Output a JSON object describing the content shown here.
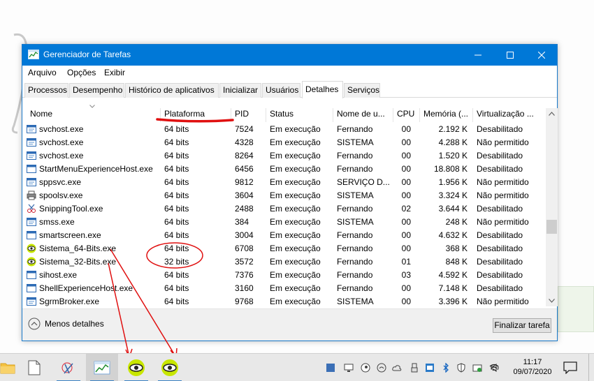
{
  "window": {
    "title": "Gerenciador de Tarefas",
    "accent": "#0078d7"
  },
  "menu": [
    "Arquivo",
    "Opções",
    "Exibir"
  ],
  "tabs": [
    "Processos",
    "Desempenho",
    "Histórico de aplicativos",
    "Inicializar",
    "Usuários",
    "Detalhes",
    "Serviços"
  ],
  "active_tab": "Detalhes",
  "columns": [
    "Nome",
    "Plataforma",
    "PID",
    "Status",
    "Nome de u...",
    "CPU",
    "Memória (...",
    "Virtualização ..."
  ],
  "rows": [
    {
      "name": "svchost.exe",
      "platform": "64 bits",
      "pid": "7524",
      "status": "Em execução",
      "user": "Fernando",
      "cpu": "00",
      "memory": "2.192 K",
      "virt": "Desabilitado",
      "icon": "service-window-icon"
    },
    {
      "name": "svchost.exe",
      "platform": "64 bits",
      "pid": "4328",
      "status": "Em execução",
      "user": "SISTEMA",
      "cpu": "00",
      "memory": "4.288 K",
      "virt": "Não permitido",
      "icon": "service-window-icon"
    },
    {
      "name": "svchost.exe",
      "platform": "64 bits",
      "pid": "8264",
      "status": "Em execução",
      "user": "Fernando",
      "cpu": "00",
      "memory": "1.520 K",
      "virt": "Desabilitado",
      "icon": "service-window-icon"
    },
    {
      "name": "StartMenuExperienceHost.exe",
      "platform": "64 bits",
      "pid": "6456",
      "status": "Em execução",
      "user": "Fernando",
      "cpu": "00",
      "memory": "18.808 K",
      "virt": "Desabilitado",
      "icon": "app-window-icon"
    },
    {
      "name": "sppsvc.exe",
      "platform": "64 bits",
      "pid": "9812",
      "status": "Em execução",
      "user": "SERVIÇO D...",
      "cpu": "00",
      "memory": "1.956 K",
      "virt": "Não permitido",
      "icon": "service-window-icon"
    },
    {
      "name": "spoolsv.exe",
      "platform": "64 bits",
      "pid": "3604",
      "status": "Em execução",
      "user": "SISTEMA",
      "cpu": "00",
      "memory": "3.324 K",
      "virt": "Não permitido",
      "icon": "printer-icon"
    },
    {
      "name": "SnippingTool.exe",
      "platform": "64 bits",
      "pid": "2488",
      "status": "Em execução",
      "user": "Fernando",
      "cpu": "02",
      "memory": "3.644 K",
      "virt": "Desabilitado",
      "icon": "scissors-icon"
    },
    {
      "name": "smss.exe",
      "platform": "64 bits",
      "pid": "384",
      "status": "Em execução",
      "user": "SISTEMA",
      "cpu": "00",
      "memory": "248 K",
      "virt": "Não permitido",
      "icon": "service-window-icon"
    },
    {
      "name": "smartscreen.exe",
      "platform": "64 bits",
      "pid": "3004",
      "status": "Em execução",
      "user": "Fernando",
      "cpu": "00",
      "memory": "4.632 K",
      "virt": "Desabilitado",
      "icon": "app-window-icon"
    },
    {
      "name": "Sistema_64-Bits.exe",
      "platform": "64 bits",
      "pid": "6708",
      "status": "Em execução",
      "user": "Fernando",
      "cpu": "00",
      "memory": "368 K",
      "virt": "Desabilitado",
      "icon": "eye-icon"
    },
    {
      "name": "Sistema_32-Bits.exe",
      "platform": "32 bits",
      "pid": "3572",
      "status": "Em execução",
      "user": "Fernando",
      "cpu": "01",
      "memory": "848 K",
      "virt": "Desabilitado",
      "icon": "eye-icon"
    },
    {
      "name": "sihost.exe",
      "platform": "64 bits",
      "pid": "7376",
      "status": "Em execução",
      "user": "Fernando",
      "cpu": "03",
      "memory": "4.592 K",
      "virt": "Desabilitado",
      "icon": "app-window-icon"
    },
    {
      "name": "ShellExperienceHost.exe",
      "platform": "64 bits",
      "pid": "3160",
      "status": "Em execução",
      "user": "Fernando",
      "cpu": "00",
      "memory": "7.148 K",
      "virt": "Desabilitado",
      "icon": "app-window-icon"
    },
    {
      "name": "SgrmBroker.exe",
      "platform": "64 bits",
      "pid": "9768",
      "status": "Em execução",
      "user": "SISTEMA",
      "cpu": "00",
      "memory": "3.396 K",
      "virt": "Não permitido",
      "icon": "service-window-icon"
    }
  ],
  "footer": {
    "less_details": "Menos detalhes",
    "end_task": "Finalizar tarefa"
  },
  "annotation_color": "#e01010",
  "taskbar": {
    "apps": [
      "folder-icon",
      "document-icon",
      "snipping-tool-icon",
      "task-manager-icon",
      "eye-icon",
      "eye-icon"
    ],
    "tray": [
      "tablet-icon",
      "monitor-icon",
      "steam-icon",
      "wifi-app-icon",
      "cloud-icon",
      "usb-icon",
      "network-app-icon",
      "bluetooth-icon",
      "shield-icon",
      "security-icon",
      "wifi-icon",
      "volume-icon"
    ],
    "time": "11:17",
    "date": "09/07/2020"
  }
}
